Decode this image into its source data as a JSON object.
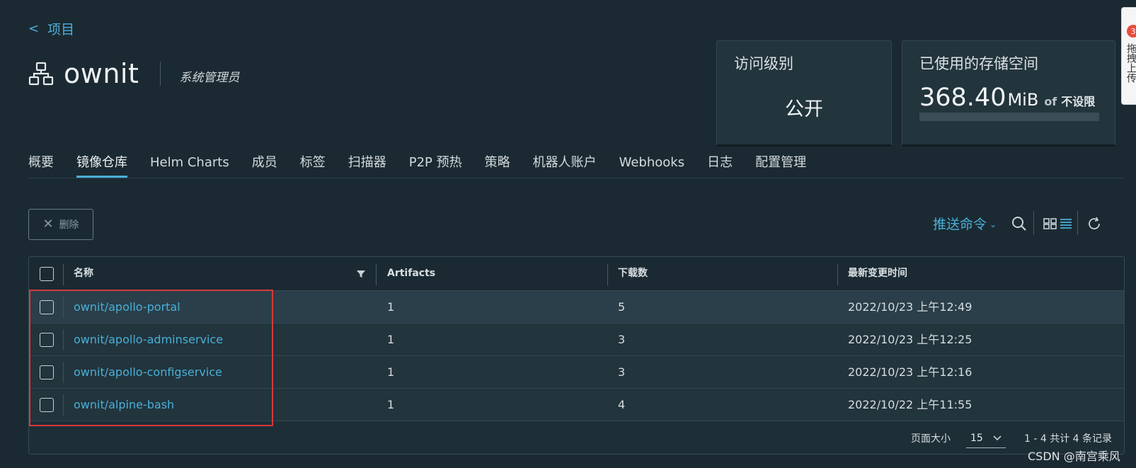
{
  "nav": {
    "back_label": "项目"
  },
  "project": {
    "name": "ownit",
    "role": "系统管理员"
  },
  "cards": {
    "access": {
      "title": "访问级别",
      "value": "公开"
    },
    "storage": {
      "title": "已使用的存储空间",
      "value": "368.40",
      "unit": "MiB",
      "of": "of",
      "limit": "不设限",
      "usage_fraction": 0
    }
  },
  "side_panel": {
    "badge": "3",
    "text": "拖拽上传"
  },
  "tabs": [
    {
      "label": "概要"
    },
    {
      "label": "镜像仓库"
    },
    {
      "label": "Helm Charts"
    },
    {
      "label": "成员"
    },
    {
      "label": "标签"
    },
    {
      "label": "扫描器"
    },
    {
      "label": "P2P 预热"
    },
    {
      "label": "策略"
    },
    {
      "label": "机器人账户"
    },
    {
      "label": "Webhooks"
    },
    {
      "label": "日志"
    },
    {
      "label": "配置管理"
    }
  ],
  "active_tab": "镜像仓库",
  "toolbar": {
    "delete_label": "删除",
    "push_command_label": "推送命令"
  },
  "table": {
    "columns": [
      "名称",
      "Artifacts",
      "下载数",
      "最新变更时间"
    ],
    "rows": [
      {
        "name": "ownit/apollo-portal",
        "artifacts": "1",
        "downloads": "5",
        "updated": "2022/10/23 上午12:49"
      },
      {
        "name": "ownit/apollo-adminservice",
        "artifacts": "1",
        "downloads": "3",
        "updated": "2022/10/23 上午12:25"
      },
      {
        "name": "ownit/apollo-configservice",
        "artifacts": "1",
        "downloads": "3",
        "updated": "2022/10/23 上午12:16"
      },
      {
        "name": "ownit/alpine-bash",
        "artifacts": "1",
        "downloads": "4",
        "updated": "2022/10/22 上午11:55"
      }
    ],
    "footer": {
      "page_size_label": "页面大小",
      "page_size": "15",
      "pagination_text": "1 - 4 共计 4 条记录"
    }
  },
  "watermark": "CSDN @南宫乘风",
  "colors": {
    "accent": "#49afd9",
    "background": "#1b2a32",
    "highlight_box": "#d8393a"
  }
}
